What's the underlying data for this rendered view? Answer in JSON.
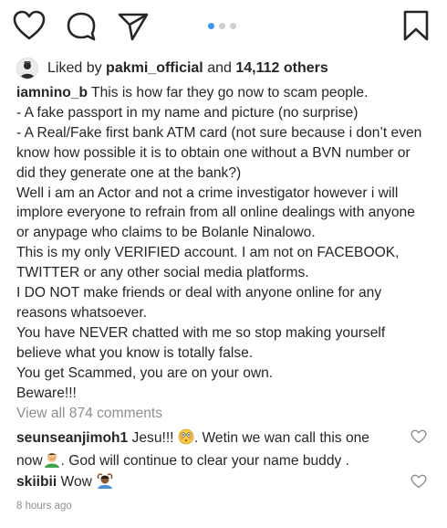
{
  "actions": {
    "like_icon": "heart-icon",
    "comment_icon": "comment-icon",
    "share_icon": "paper-plane-icon",
    "save_icon": "bookmark-icon",
    "carousel_dots": 3,
    "carousel_active_index": 0,
    "accent_color": "#3897f0"
  },
  "likes": {
    "prefix": "Liked by",
    "user": "pakmi_official",
    "joiner": "and",
    "others": "14,112 others"
  },
  "caption": {
    "username": "iamnino_b",
    "first_line": "This is how far they go now to scam people.",
    "lines": [
      "- A fake passport in my name and picture (no surprise)",
      "- A Real/Fake first bank ATM card (not sure because i don’t even",
      "know how possible it is to obtain one without a BVN number or",
      "did they generate one at the bank?)",
      "Well i am an Actor and not a crime investigator however i will",
      "implore everyone to refrain from all online dealings with anyone",
      "or anypage who claims to be Bolanle Ninalowo.",
      "This is my only VERIFIED account. I am not on FACEBOOK,",
      "TWITTER or any other social media platforms.",
      "I DO NOT make friends or deal with anyone online for any",
      "reasons whatsoever.",
      "You have NEVER chatted with me so stop making yourself",
      "believe what you know is totally false.",
      "You get Scammed, you are on your own.",
      "Beware!!!"
    ]
  },
  "view_all_comments": "View all 874 comments",
  "comments": [
    {
      "username": "seunseanjimoh1",
      "text_a": "Jesu!!!",
      "text_b": ". Wetin we wan call this one",
      "text_c": "now",
      "text_d": ". God will continue to clear your name buddy ."
    },
    {
      "username": "skiibii",
      "text": "Wow"
    }
  ],
  "timestamp": "8 hours ago"
}
